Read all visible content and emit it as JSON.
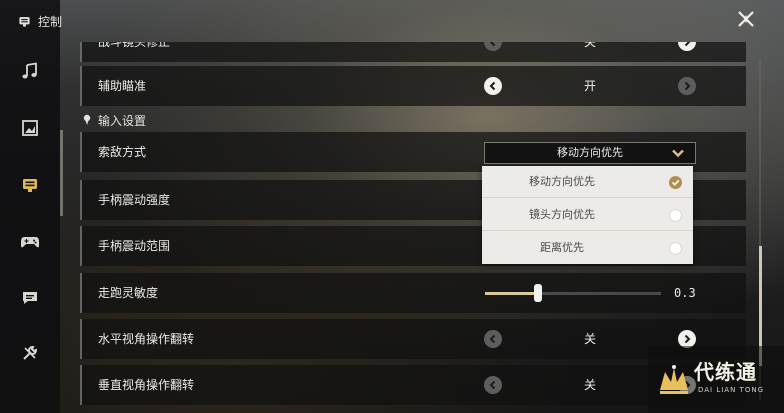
{
  "header": {
    "title": "控制"
  },
  "sidebar": {
    "items": [
      {
        "name": "sound",
        "icon": "music-note-icon"
      },
      {
        "name": "graphics",
        "icon": "picture-icon"
      },
      {
        "name": "controls",
        "icon": "controls-icon",
        "active": true
      },
      {
        "name": "gamepad",
        "icon": "gamepad-icon"
      },
      {
        "name": "chat",
        "icon": "chat-icon"
      },
      {
        "name": "other",
        "icon": "wrench-icon"
      }
    ]
  },
  "settings": {
    "partial_row": {
      "label": "战斗镜头修正",
      "value": "关"
    },
    "aim_assist": {
      "label": "辅助瞄准",
      "value": "开"
    },
    "input_section": {
      "title": "输入设置"
    },
    "target_mode": {
      "label": "索敌方式",
      "value": "移动方向优先"
    },
    "controller_vibration_strength": {
      "label": "手柄震动强度"
    },
    "controller_vibration_range": {
      "label": "手柄震动范围"
    },
    "run_sensitivity": {
      "label": "走跑灵敏度",
      "value": "0.3",
      "fill_fraction": 0.3
    },
    "invert_horizontal": {
      "label": "水平视角操作翻转",
      "value": "关"
    },
    "invert_vertical": {
      "label": "垂直视角操作翻转",
      "value": "关"
    }
  },
  "dropdown_menu": {
    "options": [
      {
        "label": "移动方向优先",
        "selected": true
      },
      {
        "label": "镜头方向优先",
        "selected": false
      },
      {
        "label": "距离优先",
        "selected": false
      }
    ]
  },
  "watermark": {
    "title": "代练通",
    "subtitle": "DAI LIAN TONG"
  },
  "colors": {
    "accent": "#b38d4f",
    "slider_fill": "#d9c99a",
    "row_bg": "#101010",
    "menu_bg": "#ecebe7"
  }
}
